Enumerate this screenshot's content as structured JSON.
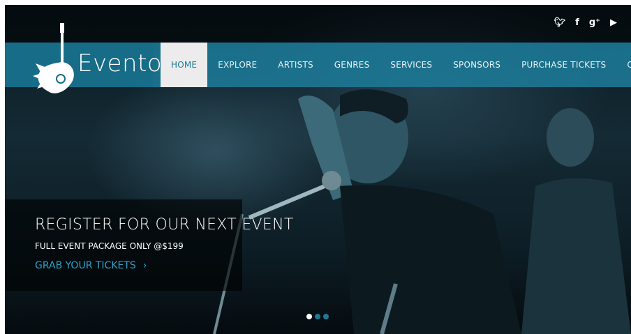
{
  "brand": {
    "name": "Evento"
  },
  "social": [
    {
      "name": "twitter-icon",
      "glyph": "🐦︎"
    },
    {
      "name": "facebook-icon",
      "glyph": "f"
    },
    {
      "name": "google-plus-icon",
      "glyph": "g⁺"
    },
    {
      "name": "youtube-icon",
      "glyph": "▶"
    }
  ],
  "nav": {
    "items": [
      {
        "label": "HOME",
        "active": true
      },
      {
        "label": "EXPLORE"
      },
      {
        "label": "ARTISTS"
      },
      {
        "label": "GENRES"
      },
      {
        "label": "SERVICES"
      },
      {
        "label": "SPONSORS"
      },
      {
        "label": "PURCHASE TICKETS"
      },
      {
        "label": "CONTACT"
      }
    ]
  },
  "hero": {
    "title": "REGISTER FOR OUR NEXT EVENT",
    "subtitle": "FULL EVENT PACKAGE ONLY @$199",
    "cta": "GRAB YOUR TICKETS",
    "cta_icon": "chevron-right-icon",
    "slides": 3,
    "active_slide": 1
  },
  "colors": {
    "brand": "#1d7a97",
    "accent": "#2aa4c9",
    "active_bg": "#ececec"
  }
}
